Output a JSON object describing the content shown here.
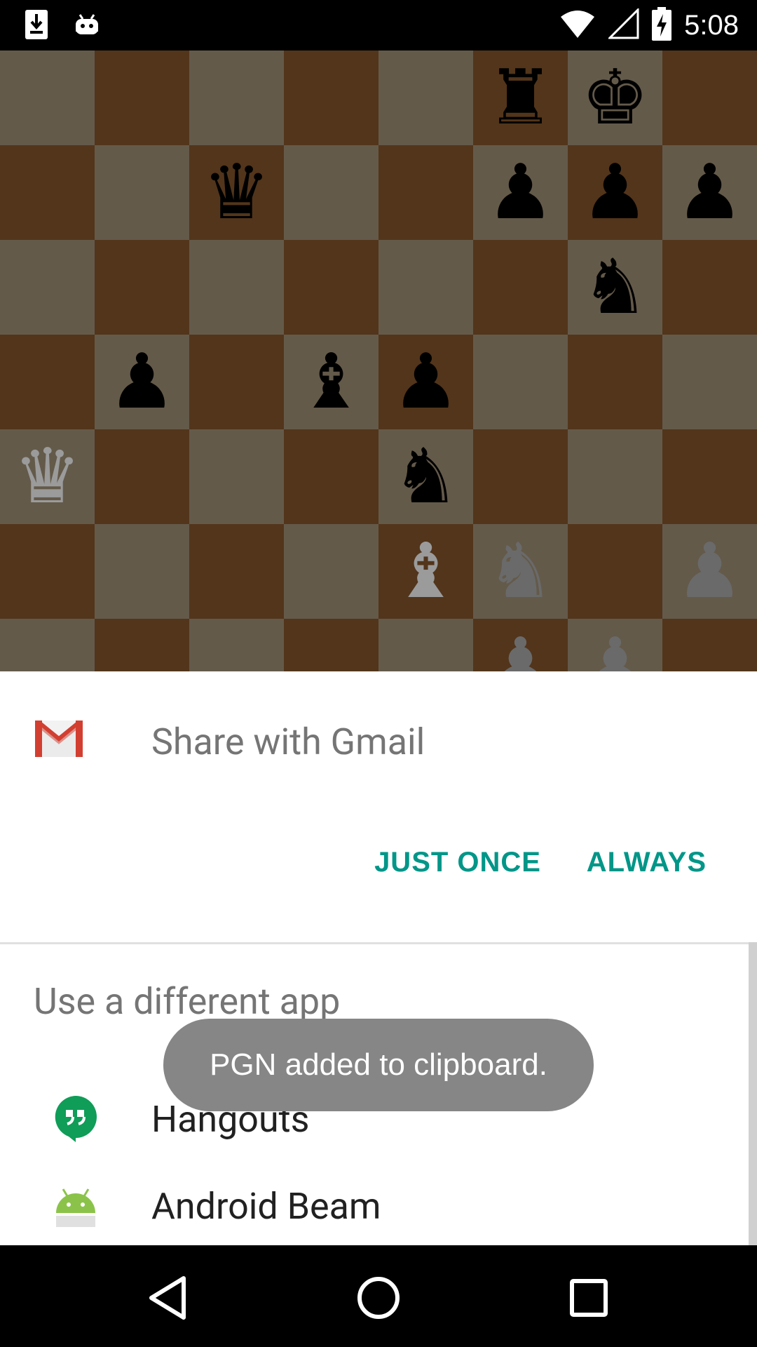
{
  "status_bar": {
    "time": "5:08",
    "icons": [
      "download-icon",
      "android-debug-icon",
      "wifi-icon",
      "signal-icon",
      "battery-charging-icon"
    ]
  },
  "board": {
    "rows": [
      [
        "",
        "",
        "",
        "",
        "",
        "bR",
        "bK",
        ""
      ],
      [
        "",
        "",
        "bQ",
        "",
        "",
        "bP",
        "bP",
        "bP"
      ],
      [
        "",
        "",
        "",
        "",
        "",
        "",
        "bN",
        ""
      ],
      [
        "",
        "bP",
        "",
        "bB",
        "bP",
        "",
        "",
        ""
      ],
      [
        "wQ",
        "",
        "",
        "",
        "bN",
        "",
        "",
        ""
      ],
      [
        "",
        "",
        "",
        "",
        "wB",
        "wN",
        "",
        "wP"
      ],
      [
        "",
        "",
        "",
        "",
        "",
        "wP",
        "wP",
        ""
      ],
      [
        "",
        "",
        "",
        "",
        "",
        "",
        "",
        ""
      ]
    ],
    "colors": {
      "light": "#645a4a",
      "dark": "#52351b"
    }
  },
  "dialog": {
    "share_title": "Share with Gmail",
    "just_once": "JUST ONCE",
    "always": "ALWAYS",
    "alt_title": "Use a different app",
    "apps": [
      {
        "label": "Hangouts",
        "icon": "hangouts-icon"
      },
      {
        "label": "Android Beam",
        "icon": "android-icon"
      }
    ],
    "accent": "#009688"
  },
  "toast": {
    "message": "PGN added to clipboard."
  },
  "nav_bar": {
    "buttons": [
      "back-icon",
      "home-icon",
      "recents-icon"
    ]
  }
}
